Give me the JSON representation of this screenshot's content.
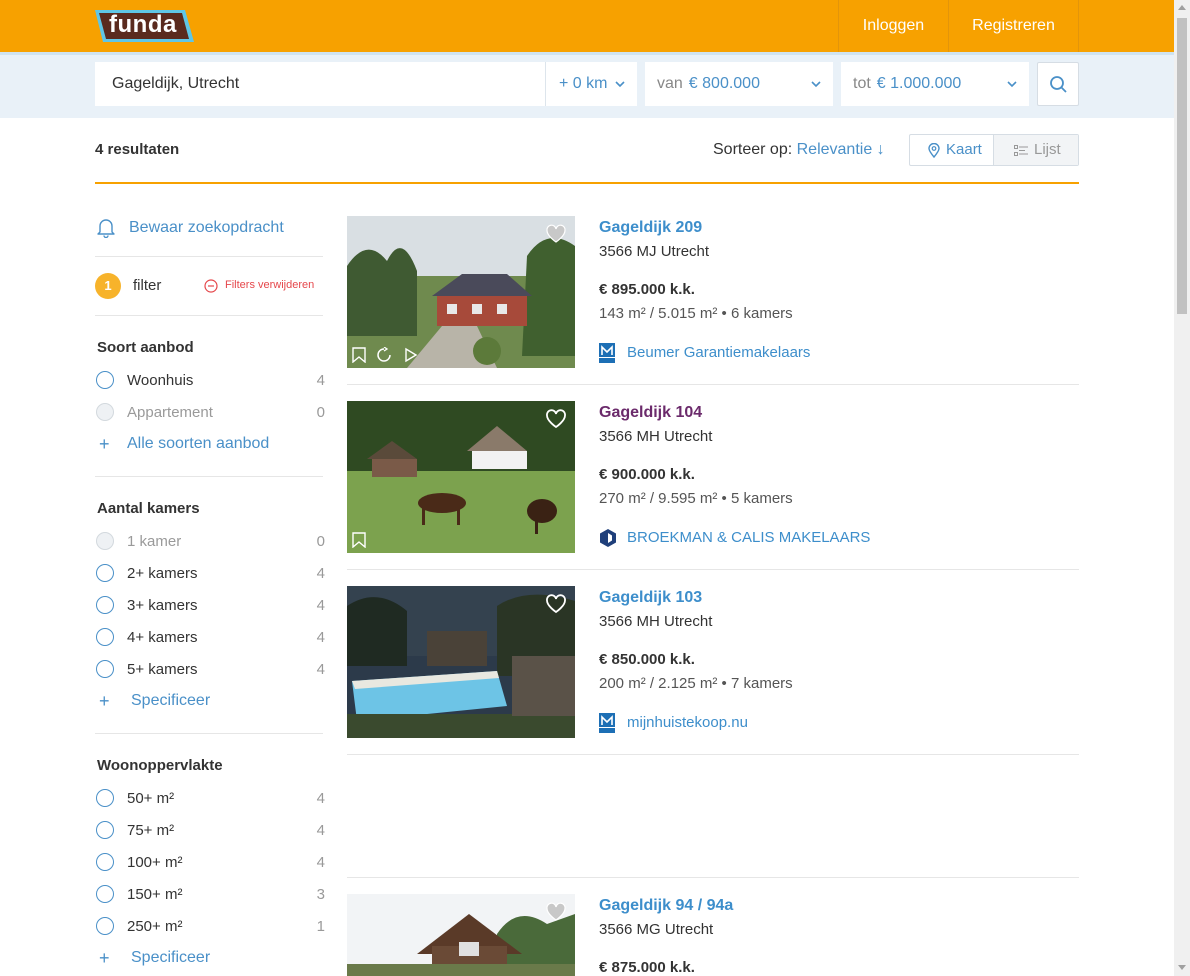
{
  "header": {
    "logo_text": "funda",
    "login_label": "Inloggen",
    "register_label": "Registreren",
    "brand_color": "#f7a100"
  },
  "search": {
    "location": "Gageldijk, Utrecht",
    "radius": "+ 0 km",
    "from_label": "van",
    "from_value": "€ 800.000",
    "to_label": "tot",
    "to_value": "€ 1.000.000"
  },
  "results": {
    "count_label": "4 resultaten",
    "sort_label": "Sorteer op:",
    "sort_value": "Relevantie ↓",
    "map_label": "Kaart",
    "list_label": "Lijst"
  },
  "sidebar": {
    "save_search": "Bewaar zoekopdracht",
    "filter_count": "1",
    "filter_label": "filter",
    "clear_filters": "Filters verwijderen",
    "groups": [
      {
        "title": "Soort aanbod",
        "options": [
          {
            "label": "Woonhuis",
            "count": "4",
            "disabled": false
          },
          {
            "label": "Appartement",
            "count": "0",
            "disabled": true
          }
        ],
        "more": "Alle soorten aanbod"
      },
      {
        "title": "Aantal kamers",
        "options": [
          {
            "label": "1 kamer",
            "count": "0",
            "disabled": true
          },
          {
            "label": "2+ kamers",
            "count": "4",
            "disabled": false
          },
          {
            "label": "3+ kamers",
            "count": "4",
            "disabled": false
          },
          {
            "label": "4+ kamers",
            "count": "4",
            "disabled": false
          },
          {
            "label": "5+ kamers",
            "count": "4",
            "disabled": false
          }
        ],
        "more": "Specificeer"
      },
      {
        "title": "Woonoppervlakte",
        "options": [
          {
            "label": "50+ m²",
            "count": "4",
            "disabled": false
          },
          {
            "label": "75+ m²",
            "count": "4",
            "disabled": false
          },
          {
            "label": "100+ m²",
            "count": "4",
            "disabled": false
          },
          {
            "label": "150+ m²",
            "count": "3",
            "disabled": false
          },
          {
            "label": "250+ m²",
            "count": "1",
            "disabled": false
          }
        ],
        "more": "Specificeer"
      }
    ]
  },
  "listings": [
    {
      "address": "Gageldijk 209",
      "zip": "3566 MJ Utrecht",
      "price": "€ 895.000 k.k.",
      "meta": "143 m² / 5.015 m² • 6 kamers",
      "agent": "Beumer Garantiemakelaars",
      "agent_logo": "nvm-logo",
      "visited": false
    },
    {
      "address": "Gageldijk 104",
      "zip": "3566 MH Utrecht",
      "price": "€ 900.000 k.k.",
      "meta": "270 m² / 9.595 m² • 5 kamers",
      "agent": "BROEKMAN & CALIS MAKELAARS",
      "agent_logo": "hexagon-logo",
      "visited": true
    },
    {
      "address": "Gageldijk 103",
      "zip": "3566 MH Utrecht",
      "price": "€ 850.000 k.k.",
      "meta": "200 m² / 2.125 m² • 7 kamers",
      "agent": "mijnhuistekoop.nu",
      "agent_logo": "nvm-logo",
      "visited": false
    },
    {
      "address": "Gageldijk 94 / 94a",
      "zip": "3566 MG Utrecht",
      "price": "€ 875.000 k.k.",
      "meta": "",
      "agent": "",
      "agent_logo": "",
      "visited": false
    }
  ],
  "colors": {
    "link": "#3d8ecb",
    "visited": "#6b2a6b",
    "danger": "#e5474b",
    "badge": "#f7b32b"
  }
}
